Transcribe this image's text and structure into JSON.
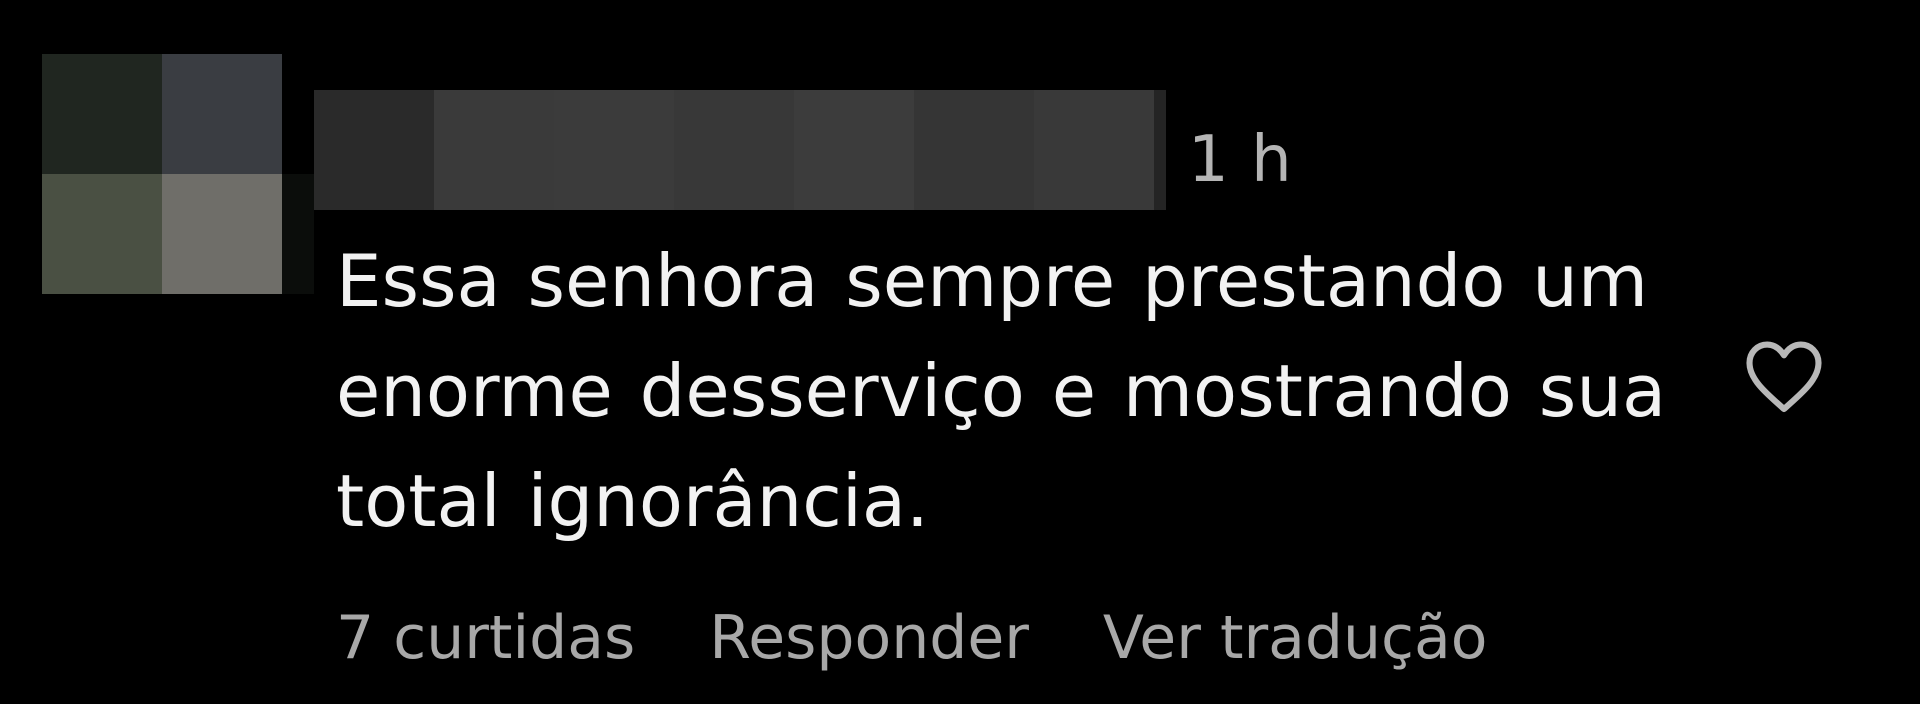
{
  "comment": {
    "timestamp": "1 h",
    "text_lines": [
      "Essa senhora sempre prestando um",
      "enorme desserviço e mostrando sua",
      "total ignorância."
    ],
    "likes_label": "7 curtidas",
    "reply_label": "Responder",
    "translate_label": "Ver tradução",
    "like_icon": "heart-outline-icon"
  },
  "colors": {
    "background": "#000000",
    "text_primary": "#f2f2f2",
    "text_secondary": "#a8a8a8"
  }
}
